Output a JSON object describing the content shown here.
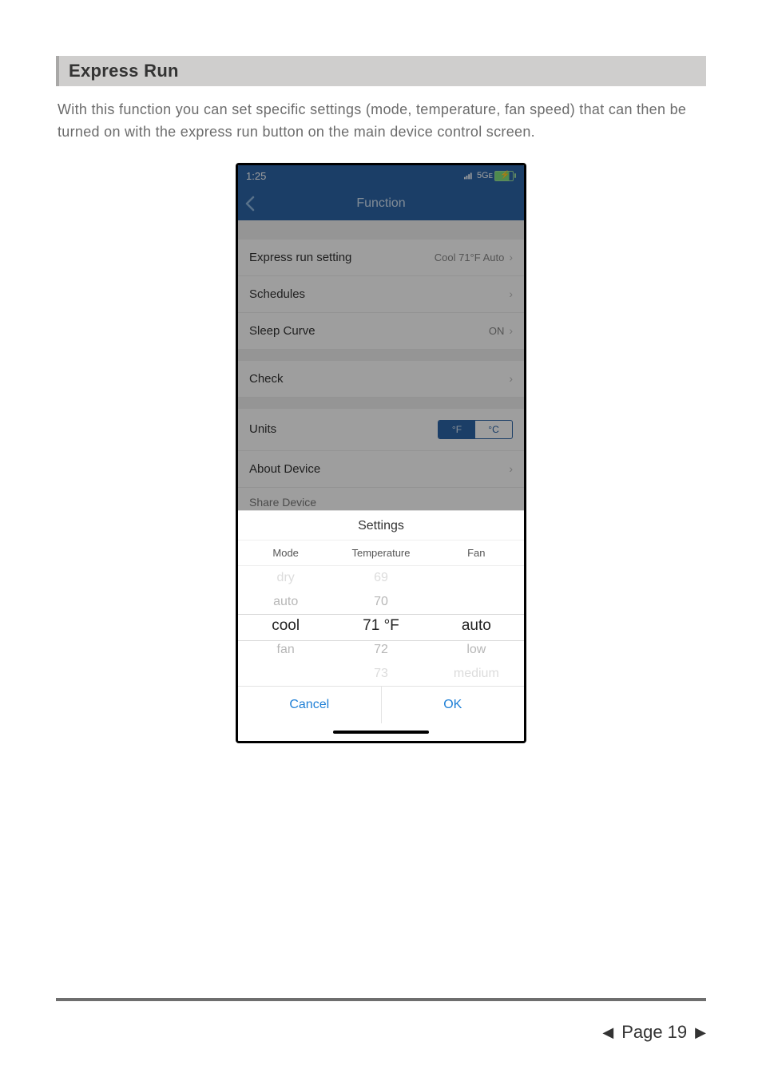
{
  "section": {
    "title": "Express Run"
  },
  "description": "With this function you can set specific settings (mode, temperature, fan speed) that can then be turned on with the express run button on the main device control screen.",
  "phone": {
    "status": {
      "time": "1:25",
      "network": "5Gᴇ"
    },
    "nav": {
      "title": "Function"
    },
    "rows": {
      "express": {
        "label": "Express run setting",
        "value": "Cool 71°F Auto"
      },
      "schedules": {
        "label": "Schedules"
      },
      "sleep": {
        "label": "Sleep Curve",
        "value": "ON"
      },
      "check": {
        "label": "Check"
      },
      "units": {
        "label": "Units",
        "f": "°F",
        "c": "°C"
      },
      "about": {
        "label": "About Device"
      },
      "share": {
        "label": "Share Device"
      }
    },
    "sheet": {
      "title": "Settings",
      "headers": {
        "mode": "Mode",
        "temp": "Temperature",
        "fan": "Fan"
      },
      "mode": {
        "m2": "dry",
        "m1": "auto",
        "sel": "cool",
        "p1": "fan"
      },
      "temp": {
        "m2": "69",
        "m1": "70",
        "sel": "71 °F",
        "p1": "72",
        "p2": "73"
      },
      "fan": {
        "sel": "auto",
        "p1": "low",
        "p2": "medium"
      },
      "cancel": "Cancel",
      "ok": "OK"
    }
  },
  "footer": {
    "label": "Page 19"
  }
}
